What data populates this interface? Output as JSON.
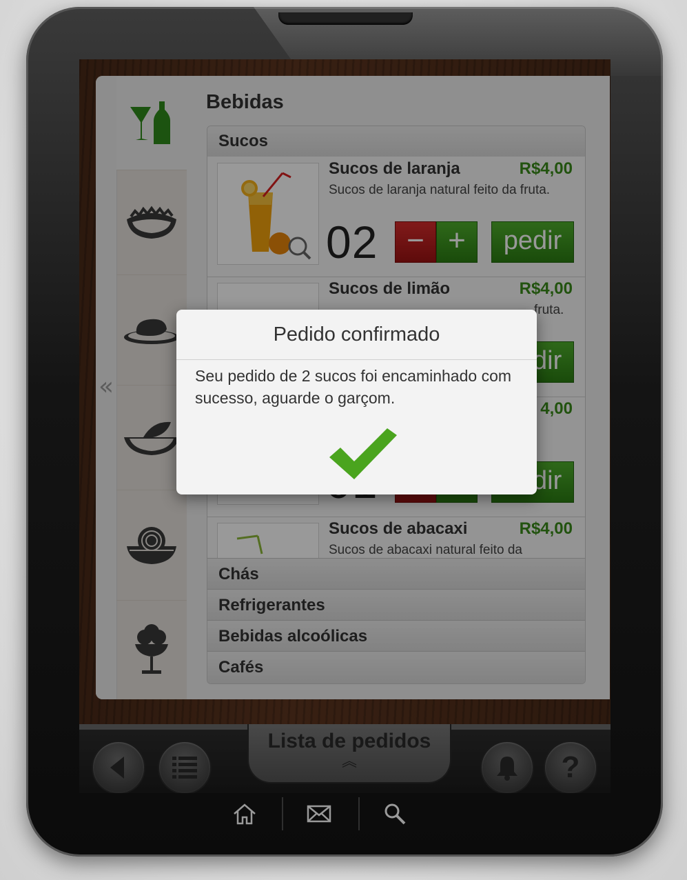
{
  "page": {
    "title": "Bebidas",
    "collapse_icon": "«"
  },
  "sidebar": {
    "categories": [
      {
        "icon": "drinks-icon",
        "active": true
      },
      {
        "icon": "salad-icon",
        "active": false
      },
      {
        "icon": "steak-icon",
        "active": false
      },
      {
        "icon": "fish-icon",
        "active": false
      },
      {
        "icon": "pasta-icon",
        "active": false
      },
      {
        "icon": "dessert-icon",
        "active": false
      }
    ]
  },
  "menu": {
    "open_section": "Sucos",
    "items": [
      {
        "name": "Sucos de laranja",
        "price": "R$4,00",
        "description": "Sucos de laranja natural feito da fruta.",
        "quantity": "02",
        "order_label": "pedir"
      },
      {
        "name": "Sucos de limão",
        "price": "R$4,00",
        "description": "fruta.",
        "quantity": "",
        "order_label": "pedir"
      },
      {
        "name": "",
        "price": "4,00",
        "description": "",
        "quantity": "01",
        "order_label": "pedir"
      },
      {
        "name": "Sucos de abacaxi",
        "price": "R$4,00",
        "description": "Sucos de abacaxi natural feito da",
        "quantity": "",
        "order_label": ""
      }
    ],
    "minus_label": "−",
    "plus_label": "+",
    "collapsed_sections": [
      "Chás",
      "Refrigerantes",
      "Bebidas alcoólicas",
      "Cafés"
    ]
  },
  "bottom_bar": {
    "orders_label": "Lista de pedidos",
    "orders_chevron": "︽",
    "buttons": [
      "back-icon",
      "list-icon",
      "bell-icon",
      "help-icon"
    ]
  },
  "dialog": {
    "title": "Pedido confirmado",
    "message": "Seu pedido de 2 sucos foi encaminhado com sucesso, aguarde o garçom.",
    "check_color": "#4aa41e"
  },
  "device_keys": [
    "home-icon",
    "mail-icon",
    "search-icon"
  ],
  "colors": {
    "green_button": "#3d9620",
    "red_button": "#c02222",
    "price_green": "#3a8a1a"
  }
}
